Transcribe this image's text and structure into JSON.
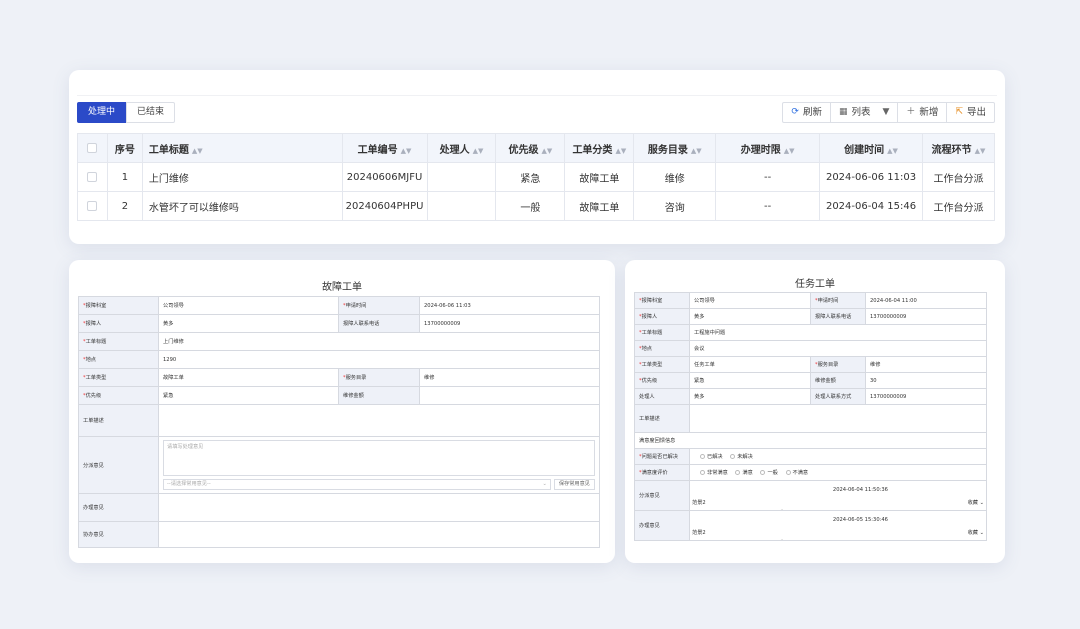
{
  "tabs": [
    {
      "label": "处理中",
      "active": true
    },
    {
      "label": "已结束",
      "active": false
    }
  ],
  "toolbar": {
    "refresh": "刷新",
    "list": "列表",
    "add": "新增",
    "export": "导出"
  },
  "table": {
    "headers": [
      "序号",
      "工单标题",
      "工单编号",
      "处理人",
      "优先级",
      "工单分类",
      "服务目录",
      "办理时限",
      "创建时间",
      "流程环节"
    ],
    "rows": [
      {
        "index": "1",
        "title": "上门维修",
        "code": "20240606MJFU",
        "handler": "",
        "priority": "紧急",
        "category": "故障工单",
        "service": "维修",
        "limit": "--",
        "created": "2024-06-06 11:03",
        "step": "工作台分派"
      },
      {
        "index": "2",
        "title": "水管坏了可以维修吗",
        "code": "20240604PHPU",
        "handler": "",
        "priority": "一般",
        "category": "故障工单",
        "service": "咨询",
        "limit": "--",
        "created": "2024-06-04 15:46",
        "step": "工作台分派"
      }
    ]
  },
  "fault_form": {
    "title": "故障工单",
    "dept_label": "报障科室",
    "dept": "公司领导",
    "apply_time_label": "申请时间",
    "apply_time": "2024-06-06 11:03",
    "reporter_label": "报障人",
    "reporter": "黄多",
    "phone_label": "报障人联系电话",
    "phone": "13700000009",
    "subject_label": "工单标题",
    "subject": "上门维修",
    "place_label": "地点",
    "place": "1290",
    "type_label": "工单类型",
    "type": "故障工单",
    "service_label": "服务目录",
    "service": "维修",
    "priority_label": "优先级",
    "priority": "紧急",
    "amount_label": "维修金额",
    "amount": "",
    "desc_label": "工单描述",
    "opinion_label": "分派意见",
    "opinion_placeholder": "请填写处理意见",
    "opinion_select": "--请选择常用意见--",
    "save_opinion": "保存常用意见",
    "handle_label": "办理意见",
    "assist_label": "协办意见"
  },
  "task_form": {
    "title": "任务工单",
    "dept_label": "报障科室",
    "dept": "公司领导",
    "apply_time_label": "申请时间",
    "apply_time": "2024-06-04 11:00",
    "reporter_label": "报障人",
    "reporter": "黄多",
    "phone_label": "报障人联系电话",
    "phone": "13700000009",
    "subject_label": "工单标题",
    "subject": "工程施中问题",
    "place_label": "地点",
    "place": "会议",
    "type_label": "工单类型",
    "type": "任务工单",
    "service_label": "服务目录",
    "service": "维修",
    "priority_label": "优先级",
    "priority": "紧急",
    "amount_label": "维修金额",
    "amount": "30",
    "handler_label": "处理人",
    "handler": "黄多",
    "handler_phone_label": "处理人联系方式",
    "handler_phone": "13700000009",
    "desc_label": "工单描述",
    "satisfaction_section": "满意度回馈信息",
    "solved_label": "问题是否已解决",
    "solved_opts": [
      "已解决",
      "未解决"
    ],
    "rating_label": "满意度评价",
    "rating_opts": [
      "非常满意",
      "满意",
      "一般",
      "不满意"
    ],
    "dispatch_label": "分派意见",
    "handle_label": "办理意见",
    "note1_who": "范景2",
    "note1_act": "收藏",
    "note1_time": "2024-06-04 11:50:36",
    "note2_who": "范景2",
    "note2_act": "收藏",
    "note2_time": "2024-06-05 15:30:46",
    "sig": "ℐ"
  }
}
